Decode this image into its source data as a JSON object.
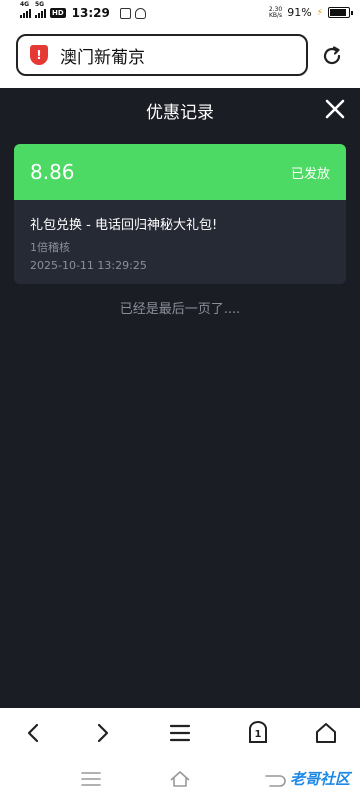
{
  "status_bar": {
    "network_1": "4G",
    "network_2": "5G",
    "hd_badge": "HD",
    "time": "13:29",
    "speed_value": "2.30",
    "speed_unit": "KB/s",
    "battery_percent": "91%",
    "battery_level": 0.91
  },
  "address_bar": {
    "url_text": "澳门新葡京",
    "site_icon": "shield-alert-icon",
    "reload_icon": "reload-icon"
  },
  "modal": {
    "title": "优惠记录",
    "close_icon": "close-icon",
    "record": {
      "amount": "8.86",
      "status": "已发放",
      "title": "礼包兑换 - 电话回归神秘大礼包!",
      "subtitle": "1倍稽核",
      "time": "2025-10-11 13:29:25"
    },
    "end_note": "已经是最后一页了...."
  },
  "toolbar": {
    "back_icon": "back-icon",
    "forward_icon": "forward-icon",
    "menu_icon": "menu-icon",
    "tabs_count": "1",
    "home_icon": "home-icon"
  },
  "system_nav": {
    "watermark": "老哥社区"
  },
  "colors": {
    "accent_green": "#4cd964",
    "background": "#1b1d24",
    "card": "#262a35",
    "alert_red": "#e53935"
  }
}
